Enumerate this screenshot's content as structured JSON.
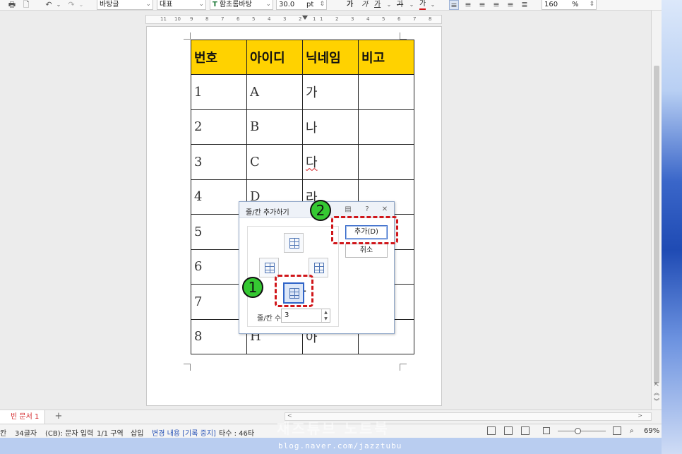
{
  "toolbar": {
    "style_select": "바탕글",
    "lang_select": "대표",
    "font_select": "함초롬바탕",
    "font_size": "30.0",
    "size_unit": "pt",
    "bold_label": "가",
    "italic_label": "가",
    "underline_label": "가",
    "strike_label": "가",
    "color_label": "가",
    "line_spacing": "160",
    "line_spacing_unit": "%"
  },
  "ruler": {
    "ticks": [
      "11",
      "10",
      "9",
      "8",
      "7",
      "6",
      "5",
      "4",
      "3",
      "2",
      "1",
      "1",
      "2",
      "3",
      "4",
      "5",
      "6",
      "7",
      "8"
    ]
  },
  "table": {
    "headers": [
      "번호",
      "아이디",
      "닉네임",
      "비고"
    ],
    "rows": [
      [
        "1",
        "A",
        "가",
        ""
      ],
      [
        "2",
        "B",
        "나",
        ""
      ],
      [
        "3",
        "C",
        "다",
        ""
      ],
      [
        "4",
        "D",
        "라",
        ""
      ],
      [
        "5",
        "",
        "",
        ""
      ],
      [
        "6",
        "",
        "",
        ""
      ],
      [
        "7",
        "",
        "",
        ""
      ],
      [
        "8",
        "H",
        "아",
        ""
      ]
    ]
  },
  "dialog": {
    "title": "줄/칸 추가하기",
    "add_button": "추가(D)",
    "cancel_button": "취소",
    "count_label": "줄/칸 수",
    "count_value": "3",
    "plus_sign": "+"
  },
  "annotations": {
    "badge1": "1",
    "badge2": "2"
  },
  "tabs": {
    "doc_tab": "빈 문서 1",
    "add_tab": "+"
  },
  "status": {
    "col": "칸",
    "chars": "34글자",
    "cb_mode": "(CB): 문자 입력",
    "section": "1/1 구역",
    "insert": "삽입",
    "changes": "변경 내용 [기록 중지]",
    "keystrokes": "타수 : 46타",
    "zoom": "69%"
  },
  "footer": {
    "url": "blog.naver.com/jazztubu",
    "watermark": "재즈튜브 노트북"
  }
}
